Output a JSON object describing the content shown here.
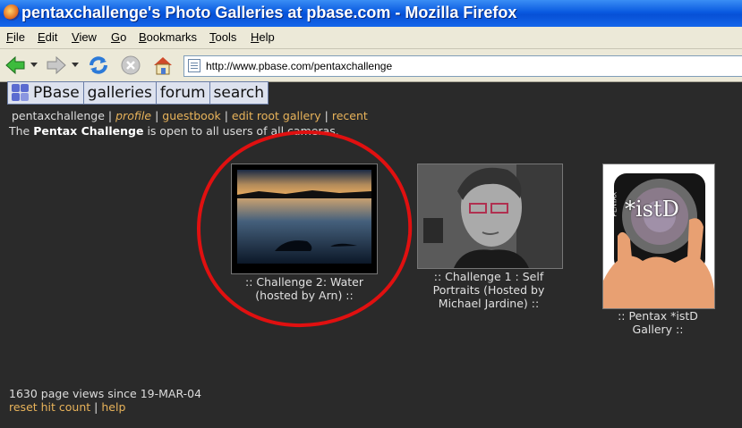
{
  "window": {
    "title": "pentaxchallenge's Photo Galleries at pbase.com - Mozilla Firefox"
  },
  "menu": [
    "File",
    "Edit",
    "View",
    "Go",
    "Bookmarks",
    "Tools",
    "Help"
  ],
  "toolbar": {
    "url": "http://www.pbase.com/pentaxchallenge"
  },
  "pbase_nav": {
    "logo": "PBase",
    "galleries": "galleries",
    "forum": "forum",
    "search": "search"
  },
  "user_links": {
    "user": "pentaxchallenge",
    "profile": "profile",
    "guestbook": "guestbook",
    "edit_root_gallery": "edit root gallery",
    "recent": "recent",
    "sep": "|"
  },
  "intro": {
    "pre": "The ",
    "bold": "Pentax Challenge",
    "post": " is open to all users of all cameras."
  },
  "galleries": [
    {
      "caption_line1": ":: Challenge 2: Water",
      "caption_line2": "(hosted by Arn) ::",
      "caption_line3": ""
    },
    {
      "caption_line1": ":: Challenge 1 : Self",
      "caption_line2": "Portraits (Hosted by",
      "caption_line3": "Michael Jardine) ::"
    },
    {
      "caption_line1": ":: Pentax *istD",
      "caption_line2": "Gallery ::",
      "caption_line3": "",
      "image_text": "*istD",
      "brand_text": "PENTAX"
    }
  ],
  "footer": {
    "views": "1630 page views since 19-MAR-04",
    "reset": "reset hit count",
    "sep": "|",
    "help": "help"
  },
  "colors": {
    "link": "#e8b35a",
    "background": "#2a2a2a",
    "annotation": "#e01010"
  }
}
